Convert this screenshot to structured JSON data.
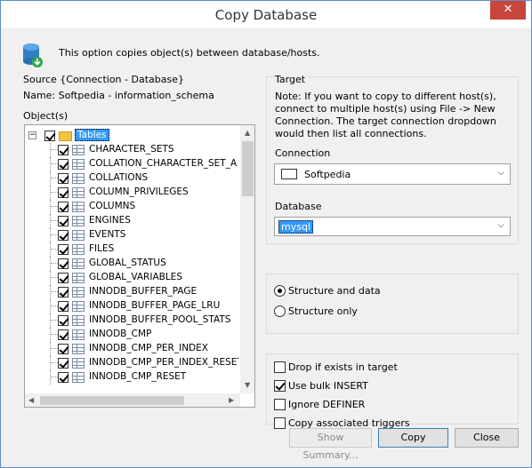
{
  "window": {
    "title": "Copy Database",
    "close_glyph": "✕"
  },
  "intro": "This option copies object(s) between database/hosts.",
  "source": {
    "label": "Source {Connection - Database}",
    "name_line": "Name:  Softpedia - information_schema",
    "objects_label": "Object(s)"
  },
  "tree": {
    "root": "Tables",
    "items": [
      "CHARACTER_SETS",
      "COLLATION_CHARACTER_SET_A",
      "COLLATIONS",
      "COLUMN_PRIVILEGES",
      "COLUMNS",
      "ENGINES",
      "EVENTS",
      "FILES",
      "GLOBAL_STATUS",
      "GLOBAL_VARIABLES",
      "INNODB_BUFFER_PAGE",
      "INNODB_BUFFER_PAGE_LRU",
      "INNODB_BUFFER_POOL_STATS",
      "INNODB_CMP",
      "INNODB_CMP_PER_INDEX",
      "INNODB_CMP_PER_INDEX_RESET",
      "INNODB_CMP_RESET"
    ]
  },
  "target": {
    "label": "Target",
    "note": "Note: If you want to copy to different host(s), connect to multiple host(s) using  File -> New Connection. The target connection dropdown would then list all connections.",
    "connection_label": "Connection",
    "connection_value": "Softpedia",
    "database_label": "Database",
    "database_value": "mysql"
  },
  "structure": {
    "option1": "Structure and data",
    "option2": "Structure only"
  },
  "options": {
    "drop": "Drop if exists in target",
    "bulk": "Use bulk INSERT",
    "definer": "Ignore DEFINER",
    "triggers": "Copy associated triggers"
  },
  "buttons": {
    "summary": "Show Summary...",
    "copy": "Copy",
    "close": "Close"
  },
  "icons": {
    "chevron": "⌵",
    "arrow_up": "▲",
    "arrow_down": "▼",
    "arrow_left": "◀",
    "arrow_right": "▶",
    "collapse": "−"
  }
}
